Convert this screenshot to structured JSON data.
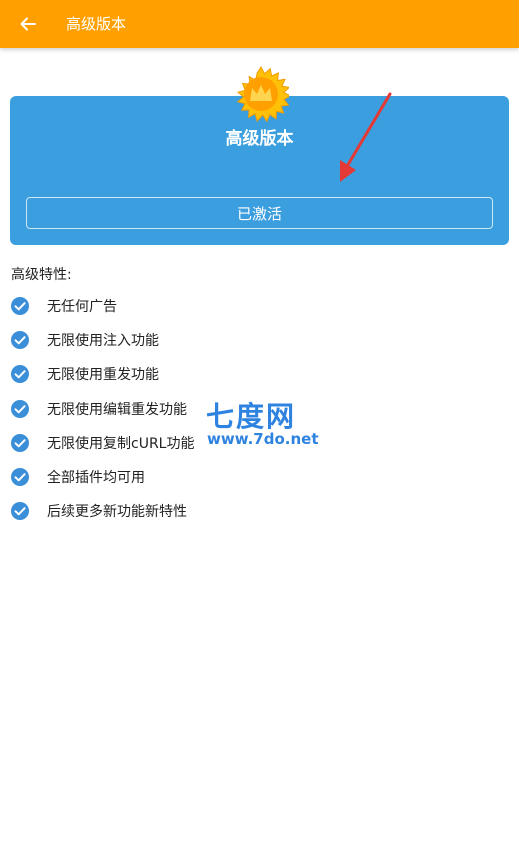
{
  "appbar": {
    "title": "高级版本",
    "back_icon": "arrow-left-icon",
    "background": "#ffa000"
  },
  "premium_card": {
    "badge_icon": "crown-badge-icon",
    "title": "高级版本",
    "status_button": "已激活",
    "background": "#3b9ede"
  },
  "features": {
    "title": "高级特性:",
    "check_icon": "check-circle-icon",
    "items": [
      {
        "label": "无任何广告"
      },
      {
        "label": "无限使用注入功能"
      },
      {
        "label": "无限使用重发功能"
      },
      {
        "label": "无限使用编辑重发功能"
      },
      {
        "label": "无限使用复制cURL功能"
      },
      {
        "label": "全部插件均可用"
      },
      {
        "label": "后续更多新功能新特性"
      }
    ]
  },
  "watermark": {
    "name": "七度网",
    "url": "www.7do.net",
    "color": "#2f83e0"
  }
}
